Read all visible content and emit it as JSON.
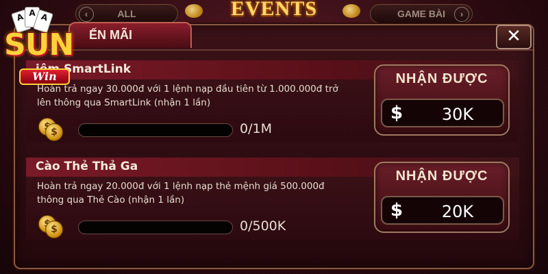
{
  "topbar": {
    "left_tab": "ALL",
    "right_tab": "GAME BÀI",
    "title": "EVENTS"
  },
  "dialog": {
    "tab_label": "ẾN MÃI",
    "close_label": "✕"
  },
  "events": [
    {
      "title": "iệm SmartLink",
      "desc_line1": "Hoàn trả ngay 30.000đ với 1 lệnh nạp đầu tiên từ 1.000.000đ trở",
      "desc_line2": "lên thông qua SmartLink (nhận 1 lần)",
      "progress_text": "0/1M",
      "progress": 0,
      "reward_label": "NHẬN ĐƯỢC",
      "reward_currency": "$",
      "reward_amount": "30K"
    },
    {
      "title": "Cào Thẻ Thả Ga",
      "desc_line1": "Hoàn trả ngay 20.000đ với 1 lệnh nạp thẻ mệnh giá 500.000đ",
      "desc_line2": "thông qua Thẻ Cào (nhận 1 lần)",
      "progress_text": "0/500K",
      "progress": 0,
      "reward_label": "NHẬN ĐƯỢC",
      "reward_currency": "$",
      "reward_amount": "20K"
    }
  ],
  "logo": {
    "brand": "SUN",
    "sub": "Win",
    "card_ranks": [
      "A",
      "A",
      "A"
    ]
  },
  "colors": {
    "accent_gold": "#ffd86a",
    "panel_red": "#7a1a28",
    "coin": "#d09010"
  }
}
